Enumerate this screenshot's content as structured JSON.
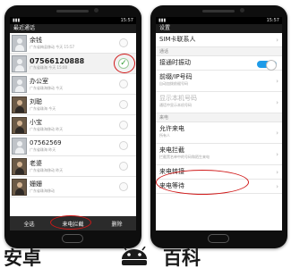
{
  "left_phone": {
    "status_time": "15:57",
    "title": "最近通话",
    "calls": [
      {
        "name": "余钱",
        "sub": "广东省梅县移动 今天 15:57",
        "selected": false
      },
      {
        "name": "07566120888",
        "sub": "广东省珠海 今天 15:00",
        "selected": true
      },
      {
        "name": "办公室",
        "sub": "广东省珠海移动 今天",
        "selected": false
      },
      {
        "name": "刘聪",
        "sub": "广东省珠海 今天",
        "selected": false
      },
      {
        "name": "小宝",
        "sub": "广东省珠海移动 昨天",
        "selected": false
      },
      {
        "name": "07562569",
        "sub": "广东省珠海 昨天",
        "selected": false
      },
      {
        "name": "老婆",
        "sub": "广东省珠海移动 昨天",
        "selected": false
      },
      {
        "name": "姗姗",
        "sub": "广东省珠海移动",
        "selected": false
      }
    ],
    "bottom_bar": {
      "select_all": "全选",
      "intercept": "来电拦截",
      "delete": "删除"
    }
  },
  "right_phone": {
    "status_time": "15:57",
    "title": "设置",
    "rows": [
      {
        "type": "row",
        "title": "SIM卡联系人",
        "sub": ""
      },
      {
        "type": "section",
        "title": "通话"
      },
      {
        "type": "toggle",
        "title": "接通时振动",
        "sub": ""
      },
      {
        "type": "row",
        "title": "前缀/IP号码",
        "sub": "自动加拨前缀号码"
      },
      {
        "type": "row",
        "title": "显示本机号码",
        "sub": "通话中显示本机号码",
        "disabled": true
      },
      {
        "type": "section",
        "title": "来电"
      },
      {
        "type": "row",
        "title": "允许来电",
        "sub": "所有人"
      },
      {
        "type": "row",
        "title": "来电拦截",
        "sub": "拦截黑名单中的号码和陌生来电"
      },
      {
        "type": "row",
        "title": "来电转接",
        "sub": ""
      },
      {
        "type": "row",
        "title": "来电等待",
        "sub": ""
      }
    ]
  },
  "watermark": {
    "left_text": "安卓",
    "right_text": "百科"
  },
  "colors": {
    "annotation": "#d01818",
    "toggle_on": "#1e9be8",
    "check": "#2e9a2e"
  }
}
